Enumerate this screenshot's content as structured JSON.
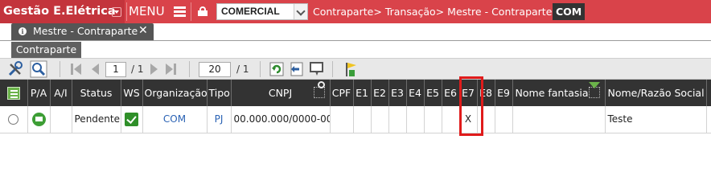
{
  "header": {
    "app_title": "Gestão E.Elétrica",
    "menu_label": "MENU",
    "module_select": "COMERCIAL",
    "breadcrumb": [
      "Contraparte>",
      "Transação>",
      "Mestre - Contraparte>"
    ],
    "breadcrumb_current": "COM",
    "accent_color": "#d9434a"
  },
  "tabs": [
    {
      "label": "Mestre - Contraparte",
      "icon": "info-icon",
      "close": "✕"
    }
  ],
  "subtab": {
    "label": "Contraparte"
  },
  "toolbar": {
    "page_current": "1",
    "page_total": "/ 1",
    "page_size": "20",
    "page_size_total": "/ 1"
  },
  "grid": {
    "headers": {
      "pa": "P/A",
      "ai": "A/I",
      "status": "Status",
      "ws": "WS",
      "org": "Organização",
      "tipo": "Tipo",
      "cnpj": "CNPJ",
      "cpf": "CPF",
      "e1": "E1",
      "e2": "E2",
      "e3": "E3",
      "e4": "E4",
      "e5": "E5",
      "e6": "E6",
      "e7": "E7",
      "e8": "E8",
      "e9": "E9",
      "nome_fantasia": "Nome fantasia",
      "razao_social": "Nome/Razão Social"
    },
    "rows": [
      {
        "status": "Pendente",
        "ws": "checked",
        "org": "COM",
        "tipo": "PJ",
        "cnpj": "00.000.000/0000-00",
        "cpf": "",
        "e1": "",
        "e2": "",
        "e3": "",
        "e4": "",
        "e5": "",
        "e6": "",
        "e7": "X",
        "e8": "",
        "e9": "",
        "nome_fantasia": "",
        "razao_social": "Teste"
      }
    ]
  }
}
